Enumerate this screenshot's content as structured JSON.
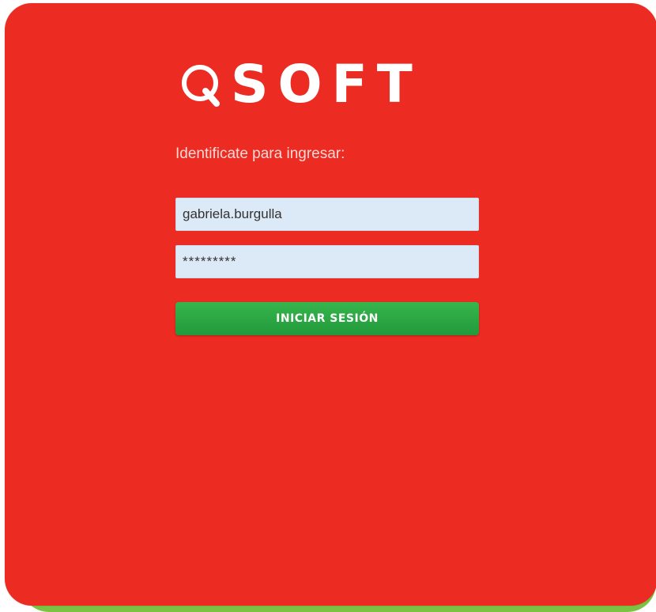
{
  "brand": {
    "logo_text": "SOFT",
    "logo_color": "#ffffff",
    "background_color": "#ec2b22",
    "accent_green": "#7cc243"
  },
  "login": {
    "prompt": "Identificate para ingresar:",
    "username_value": "gabriela.burgulla",
    "password_value": "*********",
    "submit_label": "INICIAR SESIÓN",
    "submit_color": "#2aa745"
  }
}
